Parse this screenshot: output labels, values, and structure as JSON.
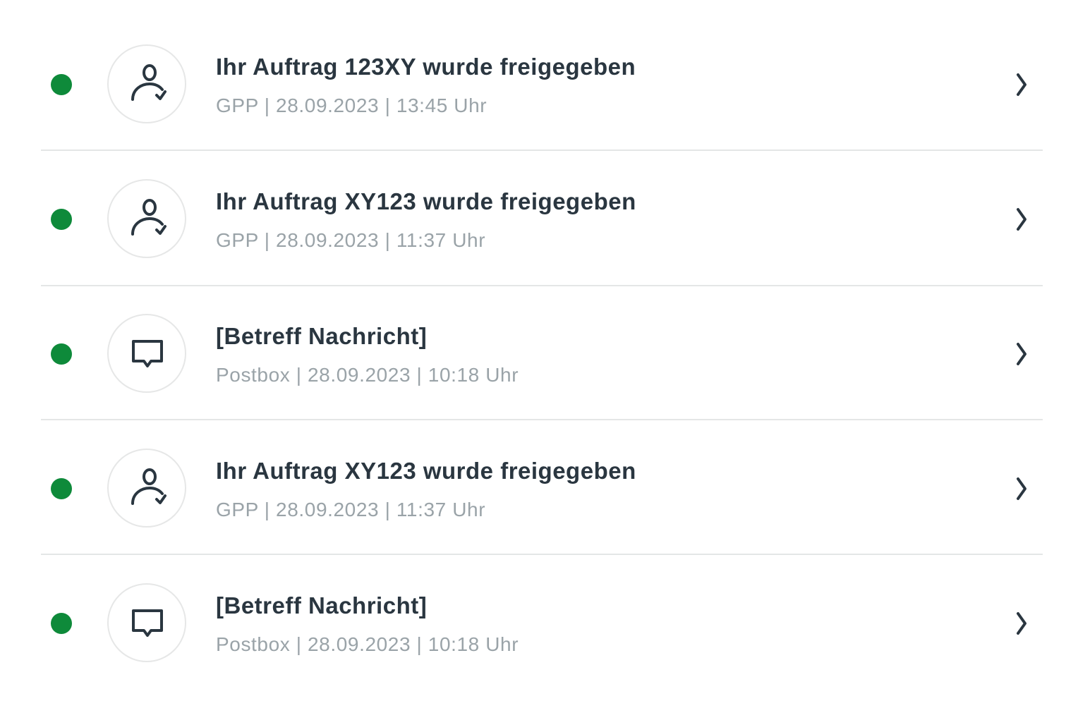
{
  "colors": {
    "unread_dot": "#0e8a3a",
    "title_text": "#2a3640",
    "meta_text": "#9aa3a8",
    "divider": "#e4e6e6"
  },
  "notifications": [
    {
      "icon": "user-check-icon",
      "title": "Ihr Auftrag 123XY wurde freigegeben",
      "meta": "GPP | 28.09.2023 | 13:45 Uhr",
      "unread": true
    },
    {
      "icon": "user-check-icon",
      "title": "Ihr Auftrag XY123 wurde freigegeben",
      "meta": "GPP | 28.09.2023 | 11:37 Uhr",
      "unread": true
    },
    {
      "icon": "chat-bubble-icon",
      "title": "[Betreff Nachricht]",
      "meta": "Postbox | 28.09.2023 | 10:18 Uhr",
      "unread": true
    },
    {
      "icon": "user-check-icon",
      "title": "Ihr Auftrag XY123 wurde freigegeben",
      "meta": "GPP | 28.09.2023 | 11:37 Uhr",
      "unread": true
    },
    {
      "icon": "chat-bubble-icon",
      "title": "[Betreff Nachricht]",
      "meta": "Postbox | 28.09.2023 | 10:18 Uhr",
      "unread": true
    }
  ]
}
